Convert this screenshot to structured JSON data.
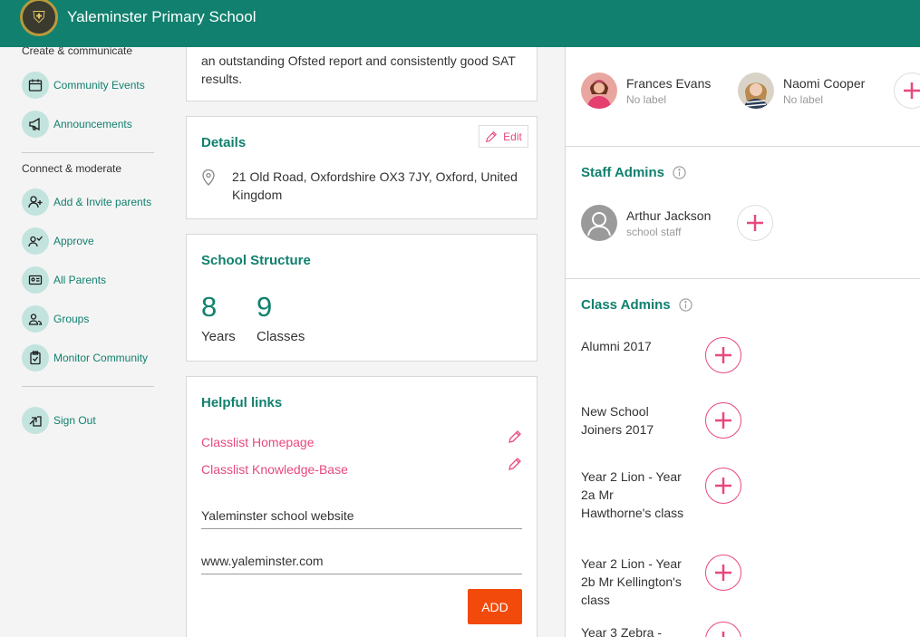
{
  "header": {
    "logo_glyph": "⛨",
    "school_name": "Yaleminster Primary School"
  },
  "sidebar": {
    "section1": "Create & communicate",
    "section2": "Connect & moderate",
    "items": [
      {
        "label": "Community Events",
        "icon": "calendar-icon"
      },
      {
        "label": "Announcements",
        "icon": "megaphone-icon"
      },
      {
        "label": "Add & Invite parents",
        "icon": "add-user-icon"
      },
      {
        "label": "Approve",
        "icon": "approve-user-icon"
      },
      {
        "label": "All Parents",
        "icon": "id-card-icon"
      },
      {
        "label": "Groups",
        "icon": "group-icon"
      },
      {
        "label": "Monitor Community",
        "icon": "clipboard-icon"
      },
      {
        "label": "Sign Out",
        "icon": "sign-out-icon"
      }
    ]
  },
  "intro": {
    "text": "an outstanding Ofsted report and consistently good SAT results."
  },
  "details": {
    "title": "Details",
    "edit_label": "Edit",
    "address": "21 Old Road, Oxfordshire OX3 7JY, Oxford, United Kingdom"
  },
  "structure": {
    "title": "School Structure",
    "years_count": "8",
    "years_label": "Years",
    "classes_count": "9",
    "classes_label": "Classes"
  },
  "links": {
    "title": "Helpful links",
    "items": [
      "Classlist Homepage",
      "Classlist Knowledge-Base"
    ],
    "name_value": "Yaleminster school website",
    "url_value": "www.yaleminster.com",
    "add_label": "ADD"
  },
  "right": {
    "people": [
      {
        "name": "Frances Evans",
        "label": "No label"
      },
      {
        "name": "Naomi Cooper",
        "label": "No label"
      }
    ],
    "staff_admins": {
      "title": "Staff Admins",
      "person": {
        "name": "Arthur Jackson",
        "label": "school staff"
      }
    },
    "class_admins": {
      "title": "Class Admins",
      "classes": [
        "Alumni 2017",
        "New School Joiners 2017",
        "Year 2 Lion - Year 2a Mr Hawthorne's class",
        "Year 2 Lion - Year 2b Mr Kellington's class",
        "Year 3 Zebra -"
      ]
    }
  },
  "colors": {
    "brand": "#11806e",
    "accent": "#e8487f",
    "button": "#f24a0a"
  }
}
